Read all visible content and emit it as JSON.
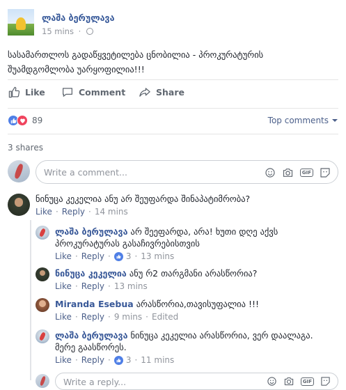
{
  "post": {
    "author": "ლაშა ბერულავა",
    "time": "15 mins",
    "body_line1": "სასამართლოს გადაწყვეტილება ცნობილია - პროკურატურის",
    "body_line2": "შუამდგომლობა უარყოფილია!!!"
  },
  "actions": {
    "like": "Like",
    "comment": "Comment",
    "share": "Share"
  },
  "reactions": {
    "count": "89",
    "sort_label": "Top comments"
  },
  "shares": "3 shares",
  "write_comment": {
    "placeholder": "Write a comment..."
  },
  "write_reply": {
    "placeholder": "Write a reply..."
  },
  "comments": [
    {
      "author": "ნინუცა კეკელია",
      "text": "ანუ არ შეუფარდა შინაპატიმრობა?",
      "like": "Like",
      "reply": "Reply",
      "time": "14 mins"
    }
  ],
  "replies": [
    {
      "author": "ლაშა ბერულავა",
      "text_line1": "არ შეეფარდა, არა! ხუთი დღე აქვს",
      "text_line2": "პროკურატურას გასაჩივრებისთვის",
      "like": "Like",
      "reply": "Reply",
      "likes": "3",
      "time": "13 mins"
    },
    {
      "author": "ნინუცა კეკელია",
      "text_line1": "ანუ რ2 თარგმანი არასწორია?",
      "like": "Like",
      "reply": "Reply",
      "time": "13 mins"
    },
    {
      "author": "Miranda Esebua",
      "text_line1": "არასწორია,თავისუფალია !!!",
      "like": "Like",
      "reply": "Reply",
      "time": "9 mins",
      "edited": "Edited"
    },
    {
      "author": "ლაშა ბერულავა",
      "text_line1": "ნინუცა კეკელია არასწორია, ვერ დაალაგა.",
      "text_line2": "მერე გაასწორეს.",
      "like": "Like",
      "reply": "Reply",
      "likes": "3",
      "time": "11 mins"
    }
  ],
  "colors": {
    "link": "#385898",
    "meta": "#90949c",
    "like_blue": "#4f7fe6",
    "love_red": "#f0445e"
  },
  "icons": [
    "globe-icon",
    "like-icon",
    "comment-icon",
    "share-icon",
    "smiley-icon",
    "camera-icon",
    "gif-icon",
    "sticker-icon"
  ]
}
